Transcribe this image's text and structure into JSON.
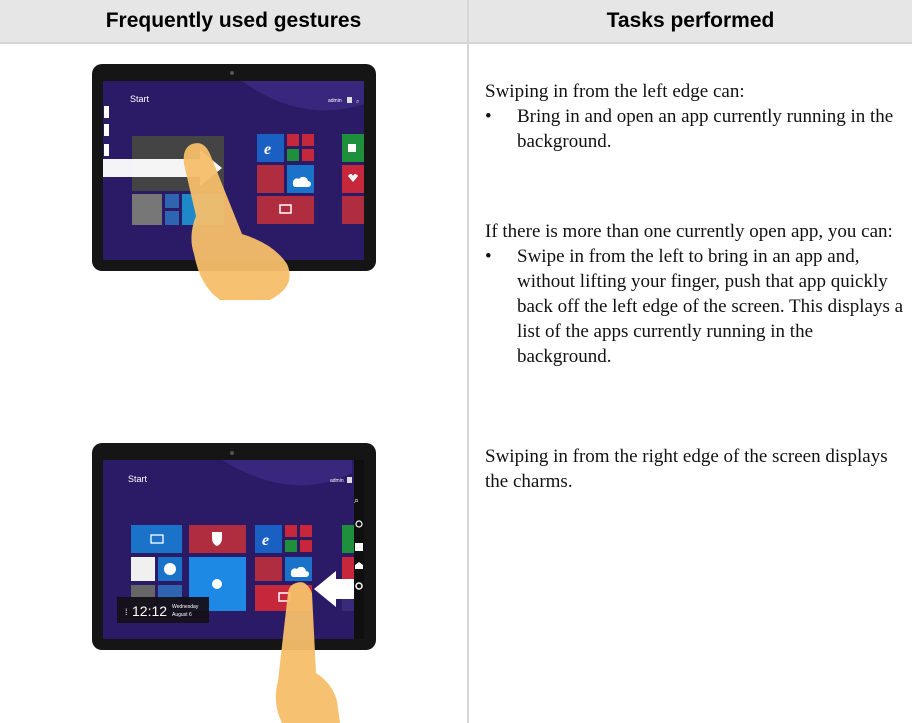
{
  "headers": {
    "gestures": "Frequently used gestures",
    "tasks": "Tasks performed"
  },
  "tasks": {
    "swipe_left_intro": "Swiping in from the left edge can:",
    "swipe_left_bullet": "Bring in and open an app currently running in the background.",
    "multi_app_intro": "If there is more than one currently open app, you can:",
    "multi_app_bullet": "Swipe in from the left to bring in an app and, without lifting your finger, push that app quickly back off the left edge of the screen. This displays a list of the apps currently running in the background.",
    "swipe_right_text": "Swiping in from the right edge of the screen displays the charms."
  },
  "bullet_char": "•",
  "tablet1": {
    "start": "Start",
    "user": "admin"
  },
  "tablet2": {
    "start": "Start",
    "user": "admin",
    "clock_time": "12:12",
    "clock_day": "Wednesday",
    "clock_date": "August 6"
  },
  "colors": {
    "header_bg": "#e6e6e6",
    "start_bg": "#2b1b66",
    "finger": "#f6bf6a",
    "tablet_frame": "#151515"
  }
}
